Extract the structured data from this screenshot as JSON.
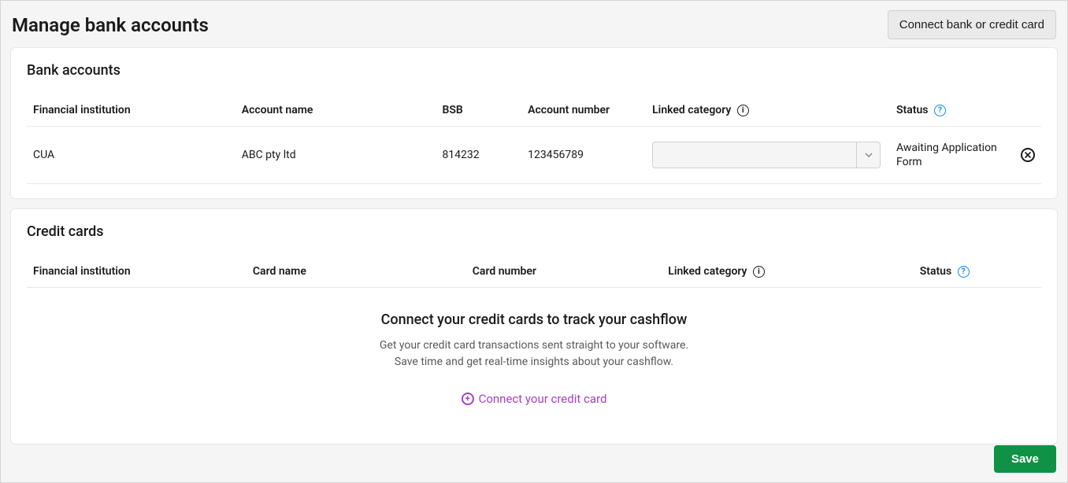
{
  "page": {
    "title": "Manage bank accounts",
    "connect_button": "Connect bank or credit card",
    "save_button": "Save"
  },
  "bank_accounts": {
    "section_title": "Bank accounts",
    "headers": {
      "financial_institution": "Financial institution",
      "account_name": "Account name",
      "bsb": "BSB",
      "account_number": "Account number",
      "linked_category": "Linked category",
      "status": "Status"
    },
    "rows": [
      {
        "financial_institution": "CUA",
        "account_name": "ABC pty ltd",
        "bsb": "814232",
        "account_number": "123456789",
        "linked_category": "",
        "status": "Awaiting Application Form"
      }
    ]
  },
  "credit_cards": {
    "section_title": "Credit cards",
    "headers": {
      "financial_institution": "Financial institution",
      "card_name": "Card name",
      "card_number": "Card number",
      "linked_category": "Linked category",
      "status": "Status"
    },
    "empty_state": {
      "title": "Connect your credit cards to track your cashflow",
      "description": "Get your credit card transactions sent straight to your software. Save time and get real-time insights about your cashflow.",
      "link_label": "Connect your credit card"
    }
  }
}
